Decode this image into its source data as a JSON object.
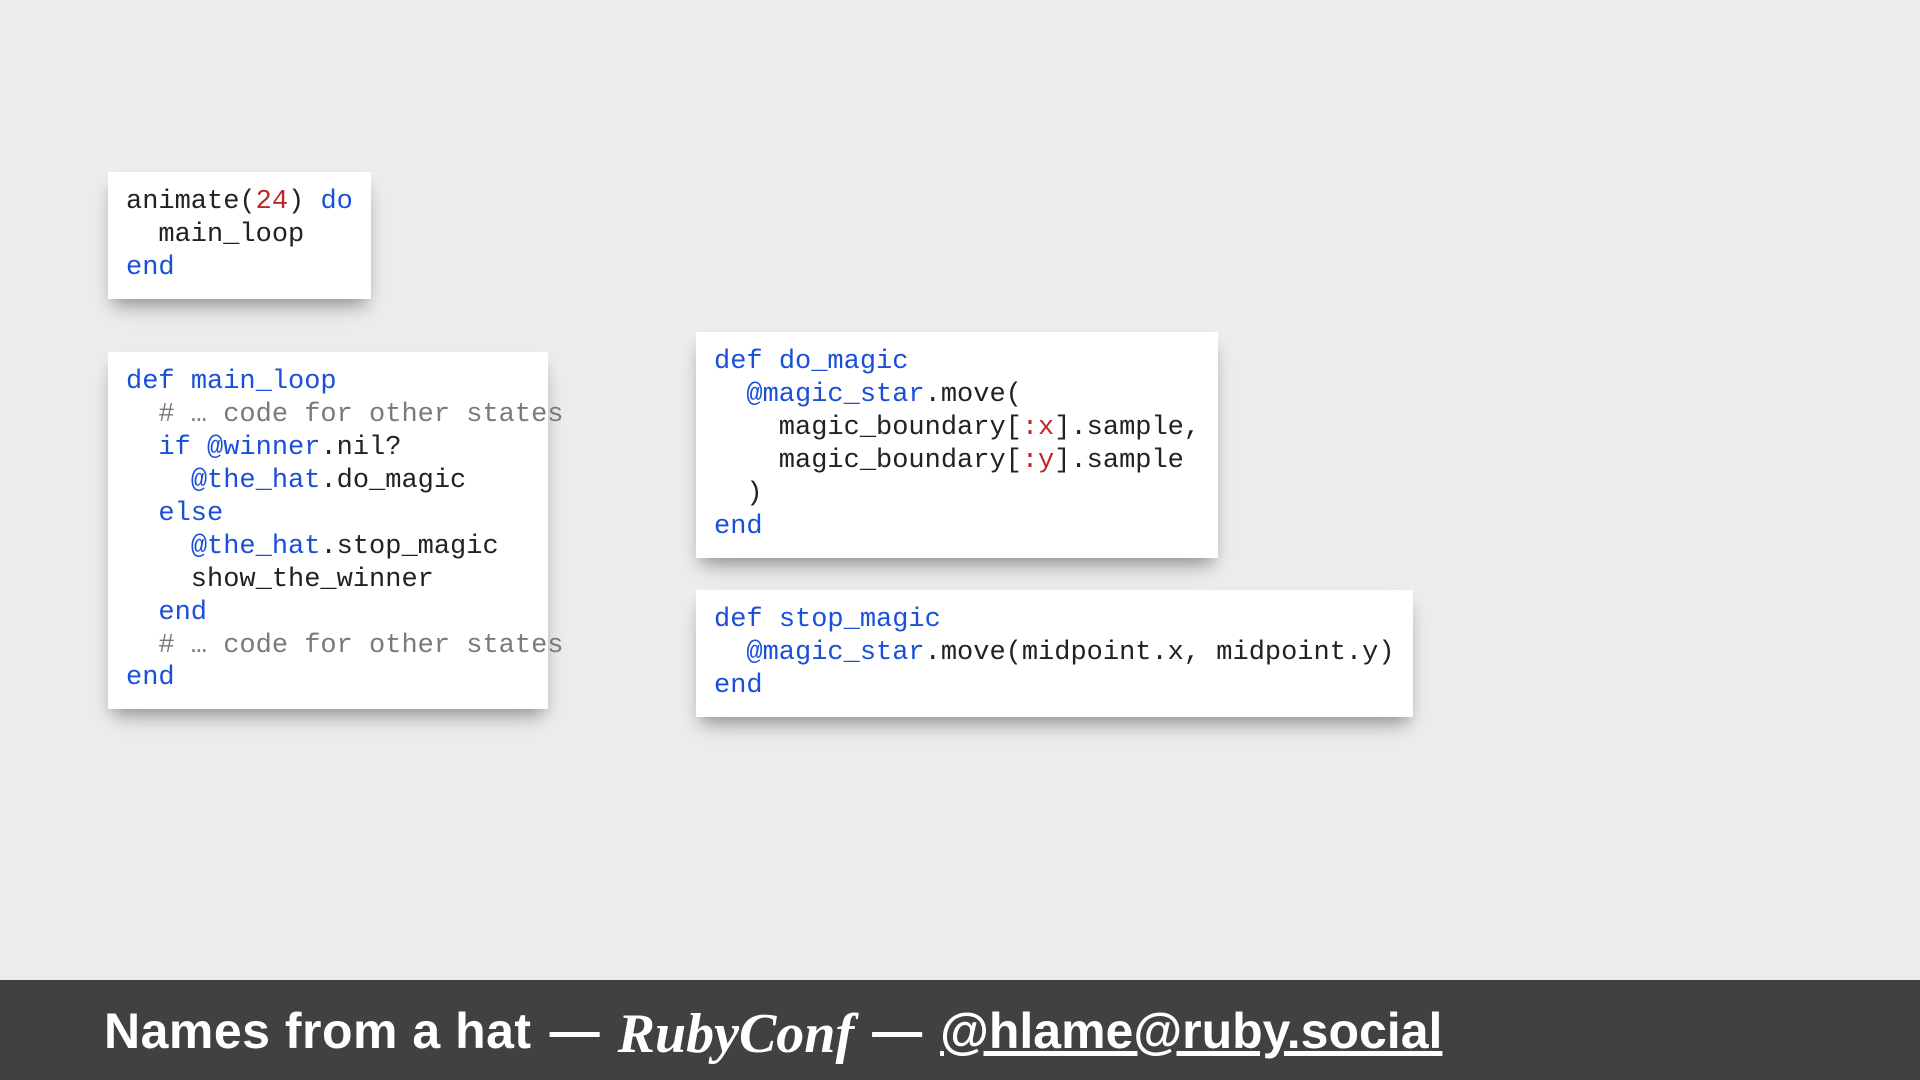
{
  "code": {
    "block1": {
      "l1a": "animate(",
      "l1b": "24",
      "l1c": ") ",
      "l1d": "do",
      "l2": "  main_loop",
      "l3": "end"
    },
    "block2": {
      "l1a": "def",
      "l1b": " ",
      "l1c": "main_loop",
      "l2a": "  ",
      "l2b": "# … code for other states",
      "l3a": "  ",
      "l3b": "if",
      "l3c": " ",
      "l3d": "@winner",
      "l3e": ".nil?",
      "l4a": "    ",
      "l4b": "@the_hat",
      "l4c": ".do_magic",
      "l5a": "  ",
      "l5b": "else",
      "l6a": "    ",
      "l6b": "@the_hat",
      "l6c": ".stop_magic",
      "l7": "    show_the_winner",
      "l8a": "  ",
      "l8b": "end",
      "l9a": "  ",
      "l9b": "# … code for other states",
      "l10": "end"
    },
    "block3": {
      "l1a": "def",
      "l1b": " ",
      "l1c": "do_magic",
      "l2a": "  ",
      "l2b": "@magic_star",
      "l2c": ".move(",
      "l3a": "    magic_boundary[",
      "l3b": ":x",
      "l3c": "].sample,",
      "l4a": "    magic_boundary[",
      "l4b": ":y",
      "l4c": "].sample",
      "l5": "  )",
      "l6": "end"
    },
    "block4": {
      "l1a": "def",
      "l1b": " ",
      "l1c": "stop_magic",
      "l2a": "  ",
      "l2b": "@magic_star",
      "l2c": ".move(midpoint.x, midpoint.y)",
      "l3": "end"
    }
  },
  "footer": {
    "talk": "Names from a hat",
    "sep": "—",
    "conf": "RubyConf",
    "handle": "@hlame@ruby.social"
  }
}
